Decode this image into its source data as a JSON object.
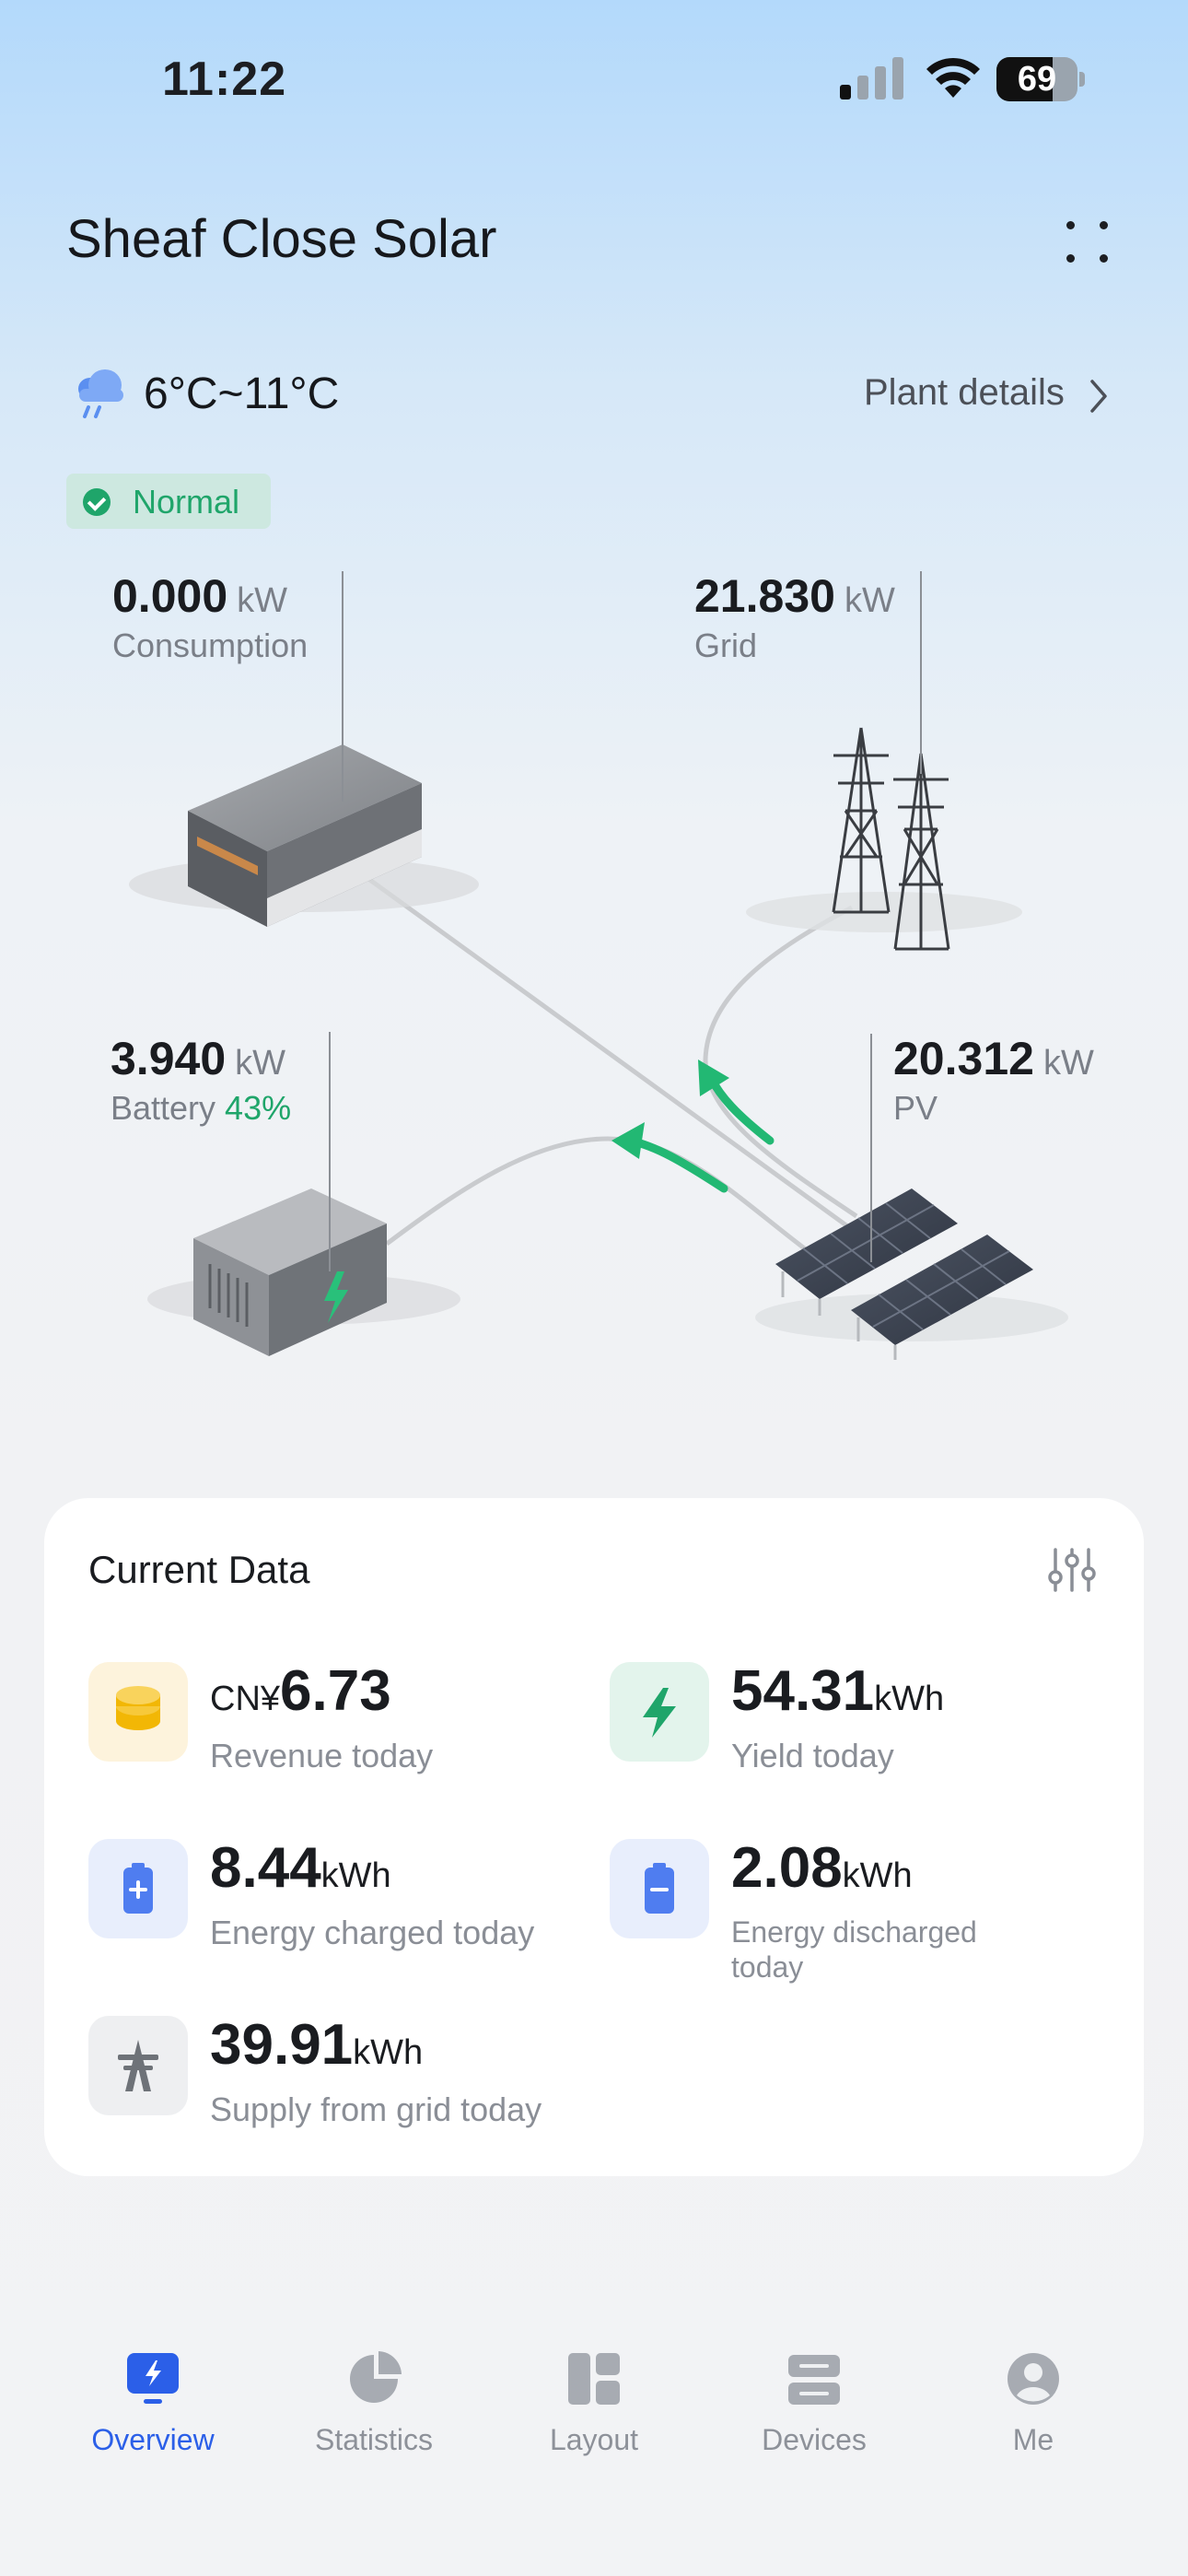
{
  "status_bar": {
    "time": "11:22",
    "battery_level": "69"
  },
  "header": {
    "plant_name": "Sheaf Close Solar"
  },
  "weather": {
    "icon": "rain-cloud-icon",
    "temperature": "6°C~11°C"
  },
  "plant_details_label": "Plant details",
  "plant_status": "Normal",
  "flow": {
    "consumption": {
      "value": "0.000",
      "unit": "kW",
      "label": "Consumption"
    },
    "grid": {
      "value": "21.830",
      "unit": "kW",
      "label": "Grid"
    },
    "battery": {
      "value": "3.940",
      "unit": "kW",
      "label": "Battery",
      "soc": "43%"
    },
    "pv": {
      "value": "20.312",
      "unit": "kW",
      "label": "PV"
    }
  },
  "current_data": {
    "title": "Current Data",
    "items": [
      {
        "prefix": "CN¥",
        "value": "6.73",
        "unit": "",
        "label": "Revenue today",
        "icon": "coins-icon"
      },
      {
        "prefix": "",
        "value": "54.31",
        "unit": "kWh",
        "label": "Yield today",
        "icon": "lightning-icon"
      },
      {
        "prefix": "",
        "value": "8.44",
        "unit": "kWh",
        "label": "Energy charged today",
        "icon": "battery-charge-icon"
      },
      {
        "prefix": "",
        "value": "2.08",
        "unit": "kWh",
        "label": "Energy discharged today",
        "icon": "battery-discharge-icon"
      },
      {
        "prefix": "",
        "value": "39.91",
        "unit": "kWh",
        "label": "Supply from grid today",
        "icon": "grid-tower-icon"
      }
    ]
  },
  "tabs": [
    {
      "label": "Overview",
      "icon": "overview-icon",
      "active": true
    },
    {
      "label": "Statistics",
      "icon": "pie-chart-icon",
      "active": false
    },
    {
      "label": "Layout",
      "icon": "layout-icon",
      "active": false
    },
    {
      "label": "Devices",
      "icon": "devices-icon",
      "active": false
    },
    {
      "label": "Me",
      "icon": "user-icon",
      "active": false
    }
  ],
  "colors": {
    "accent": "#2b5fe8",
    "positive": "#1fa56a",
    "flow_arrow": "#22b873"
  }
}
